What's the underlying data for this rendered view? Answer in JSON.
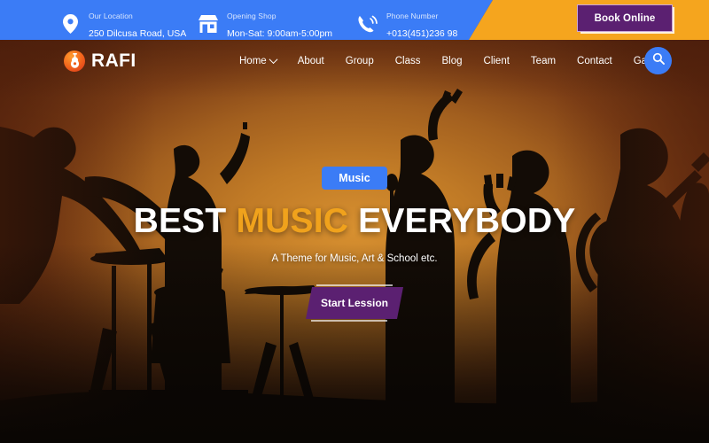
{
  "topbar": {
    "info": [
      {
        "icon": "map-pin-icon",
        "label": "Our Location",
        "value": "250 Dilcusa Road, USA"
      },
      {
        "icon": "shop-icon",
        "label": "Opening Shop",
        "value": "Mon-Sat: 9:00am-5:00pm"
      },
      {
        "icon": "phone-ring-icon",
        "label": "Phone Number",
        "value": "+013(451)236 98"
      }
    ],
    "book_button": "Book Online",
    "colors": {
      "blue": "#3b7cf6",
      "orange": "#f5a51e",
      "purple": "#5b2071"
    }
  },
  "navbar": {
    "brand": "RAFI",
    "logo_icon": "guitar-logo-icon",
    "items": [
      {
        "label": "Home",
        "has_dropdown": true
      },
      {
        "label": "About",
        "has_dropdown": false
      },
      {
        "label": "Group",
        "has_dropdown": false
      },
      {
        "label": "Class",
        "has_dropdown": false
      },
      {
        "label": "Blog",
        "has_dropdown": false
      },
      {
        "label": "Client",
        "has_dropdown": false
      },
      {
        "label": "Team",
        "has_dropdown": false
      },
      {
        "label": "Contact",
        "has_dropdown": false
      },
      {
        "label": "Gallery",
        "has_dropdown": false
      }
    ],
    "search_icon": "search-icon"
  },
  "hero": {
    "badge": "Music",
    "title_part1": "BEST ",
    "title_accent": "MUSIC",
    "title_part2": " EVERYBODY",
    "subtitle": "A Theme for Music, Art & School etc.",
    "cta_label": "Start Lession",
    "accent_color": "#f0a21c",
    "badge_color": "#3b7cf6",
    "cta_color": "#5b2071"
  }
}
